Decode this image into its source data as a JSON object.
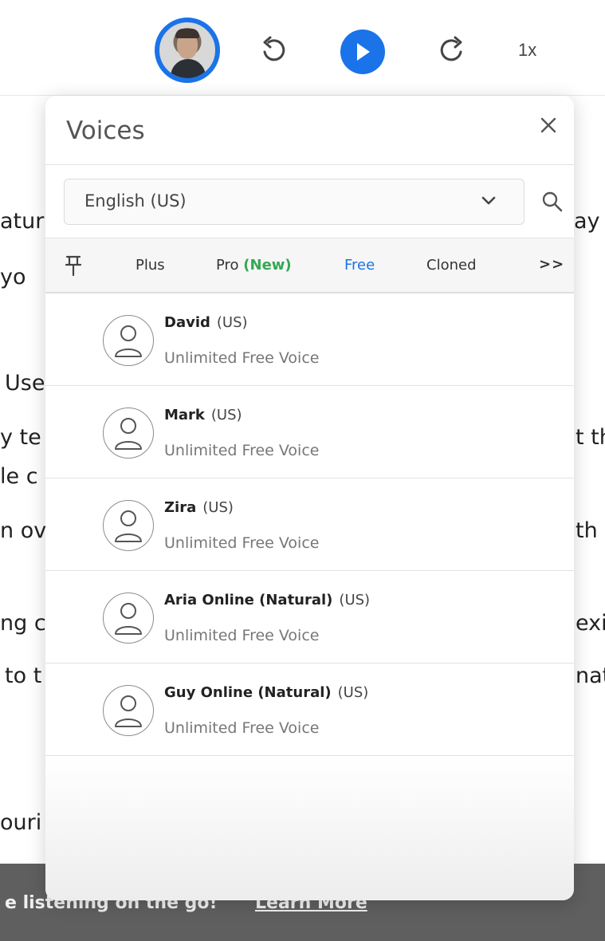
{
  "player": {
    "speed": "1x",
    "colors": {
      "accent": "#1a73e8"
    }
  },
  "background_text": [
    "atur",
    "ay",
    "yo",
    "Use",
    "y te",
    "t th",
    "le c",
    "n ov",
    "th",
    "ng c",
    "exic",
    "to t",
    "nat",
    "ouri"
  ],
  "banner": {
    "text": "e listening on the go!",
    "link": "Learn More"
  },
  "panel": {
    "title": "Voices",
    "language": "English (US)",
    "tabs": {
      "plus": "Plus",
      "pro": "Pro",
      "pro_badge": "(New)",
      "free": "Free",
      "cloned": "Cloned",
      "more": ">>"
    },
    "voices": [
      {
        "name": "David",
        "region": "(US)",
        "subtitle": "Unlimited Free Voice"
      },
      {
        "name": "Mark",
        "region": "(US)",
        "subtitle": "Unlimited Free Voice"
      },
      {
        "name": "Zira",
        "region": "(US)",
        "subtitle": "Unlimited Free Voice"
      },
      {
        "name": "Aria Online (Natural)",
        "region": "(US)",
        "subtitle": "Unlimited Free Voice"
      },
      {
        "name": "Guy Online (Natural)",
        "region": "(US)",
        "subtitle": "Unlimited Free Voice"
      }
    ]
  },
  "icons": [
    "rewind-icon",
    "play-icon",
    "forward-icon",
    "close-icon",
    "chevron-down-icon",
    "search-icon",
    "pin-icon",
    "user-icon"
  ]
}
